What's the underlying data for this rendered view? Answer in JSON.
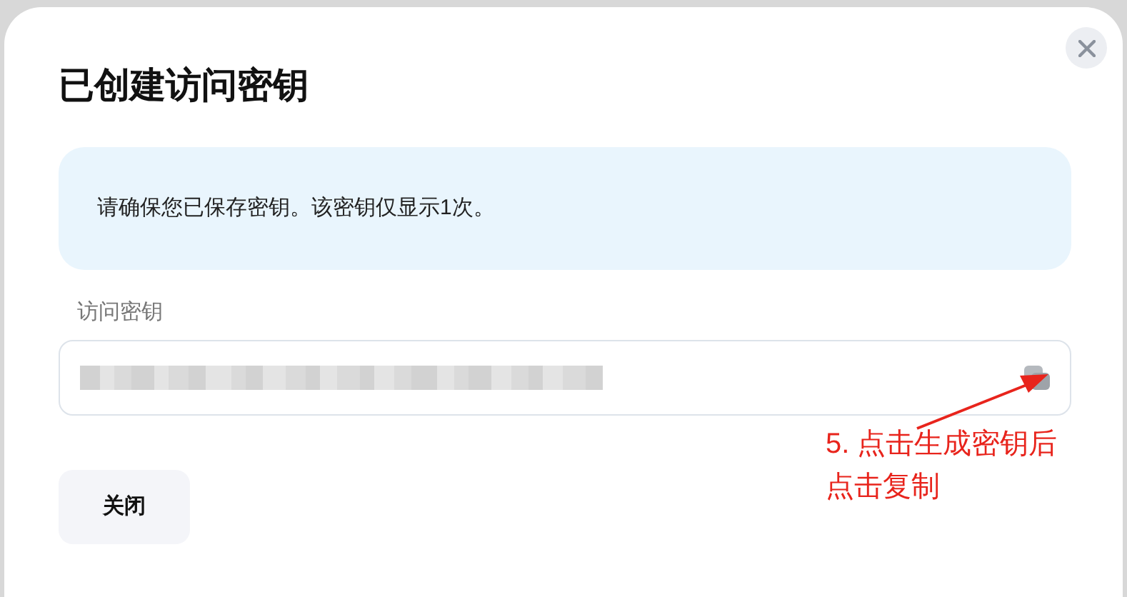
{
  "dialog": {
    "title": "已创建访问密钥",
    "notice": "请确保您已保存密钥。该密钥仅显示1次。",
    "key_field": {
      "label": "访问密钥"
    },
    "buttons": [
      {
        "label": "关闭"
      }
    ]
  },
  "annotation": {
    "lines": [
      "5. 点击生成密钥后",
      "点击复制"
    ]
  }
}
